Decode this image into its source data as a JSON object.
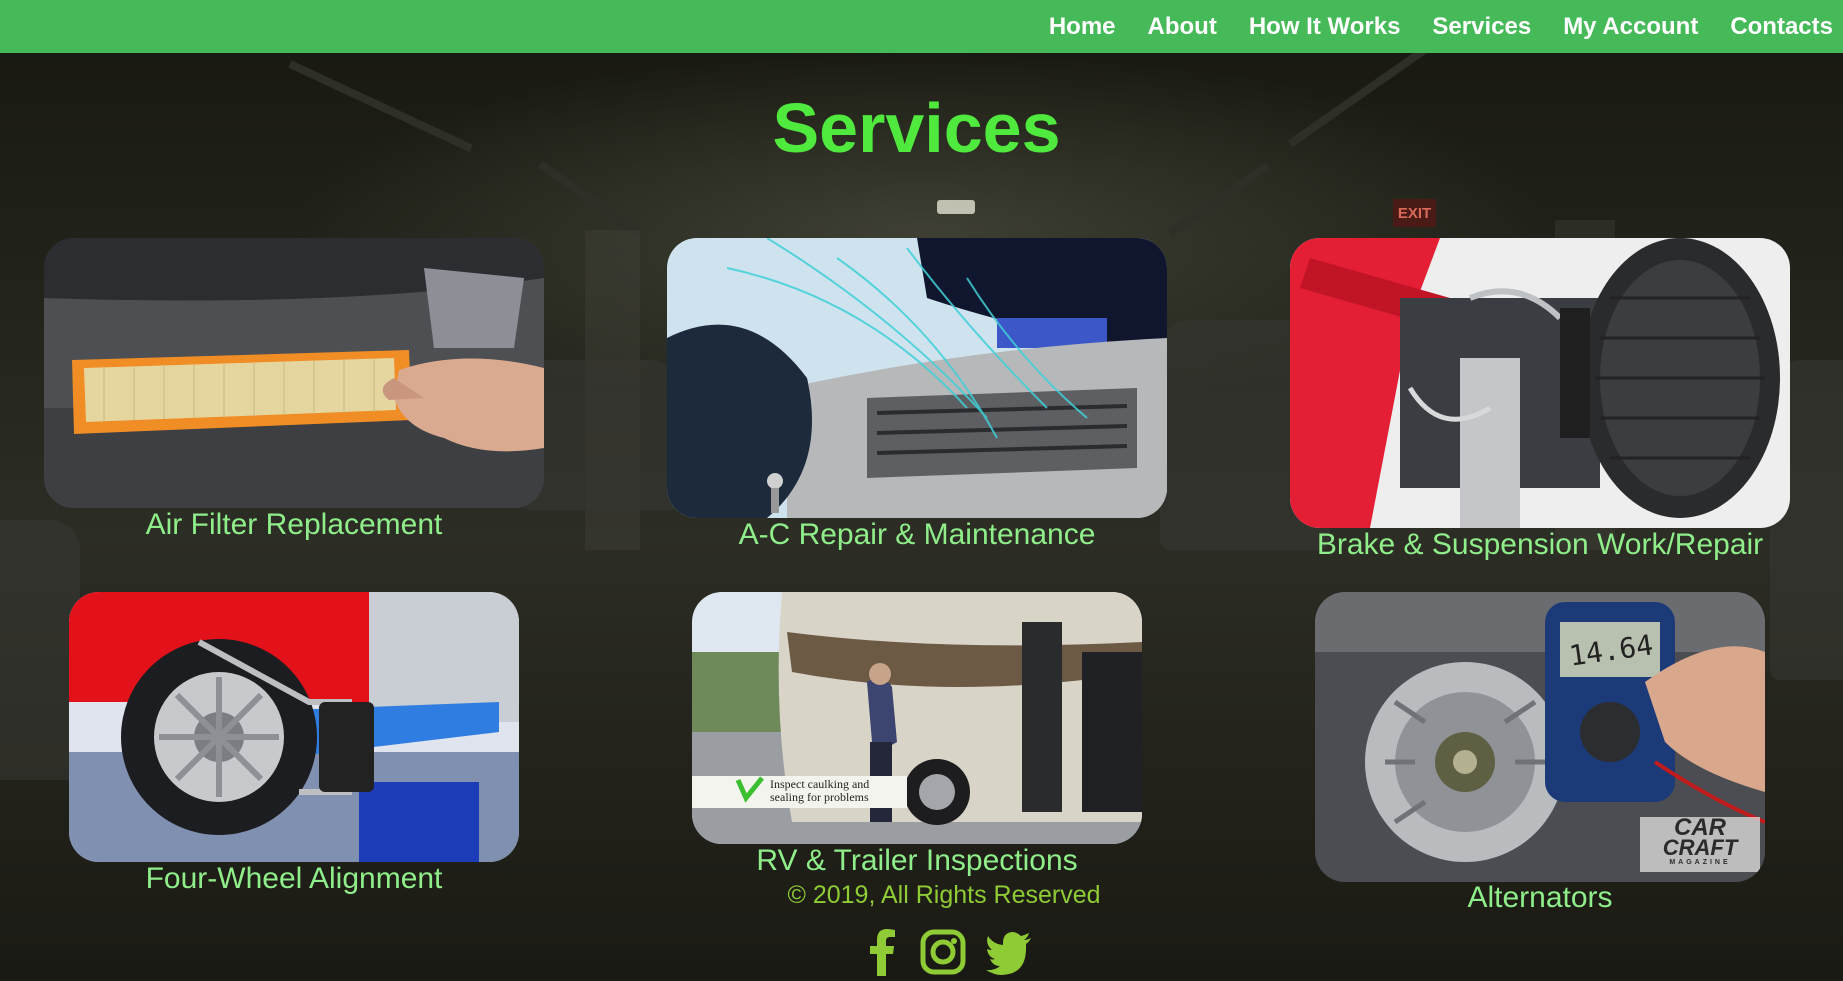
{
  "nav": {
    "items": [
      "Home",
      "About",
      "How It Works",
      "Services",
      "My Account",
      "Contacts"
    ]
  },
  "page": {
    "title": "Services"
  },
  "services": [
    {
      "label": "Air Filter Replacement",
      "image": "air-filter-photo"
    },
    {
      "label": "A-C Repair & Maintenance",
      "image": "ac-vent-photo"
    },
    {
      "label": "Brake & Suspension Work/Repair",
      "image": "brake-suspension-photo"
    },
    {
      "label": "Four-Wheel Alignment",
      "image": "wheel-alignment-photo"
    },
    {
      "label": "RV & Trailer Inspections",
      "image": "rv-inspection-photo",
      "caption": [
        "Inspect caulking and",
        "sealing for problems"
      ]
    },
    {
      "label": "Alternators",
      "image": "alternator-multimeter-photo",
      "watermark": [
        "CAR",
        "CRAFT",
        "MAGAZINE"
      ],
      "meter_reading": "14.64"
    }
  ],
  "background": {
    "sign": "EXIT"
  },
  "footer": {
    "copyright": "© 2019, All Rights Reserved",
    "social": [
      "facebook-icon",
      "instagram-icon",
      "twitter-icon"
    ]
  },
  "colors": {
    "nav_bg": "#46b959",
    "title": "#4fea3d",
    "label": "#8fee8a",
    "footer": "#8fcb35"
  }
}
